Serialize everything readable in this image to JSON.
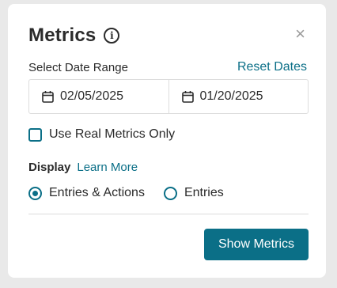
{
  "dialog": {
    "title": "Metrics",
    "info_icon": "info-icon",
    "close_glyph": "×"
  },
  "date_range": {
    "label": "Select Date Range",
    "reset_label": "Reset Dates",
    "start_date": "02/05/2025",
    "end_date": "01/20/2025",
    "icon": "calendar-icon"
  },
  "real_metrics": {
    "label": "Use Real Metrics Only",
    "checked": false
  },
  "display": {
    "label": "Display",
    "learn_more": "Learn More",
    "options": [
      {
        "label": "Entries & Actions",
        "selected": true
      },
      {
        "label": "Entries",
        "selected": false
      }
    ]
  },
  "actions": {
    "submit_label": "Show Metrics"
  },
  "colors": {
    "accent": "#0b6f87",
    "backdrop": "#e9e9e9"
  }
}
